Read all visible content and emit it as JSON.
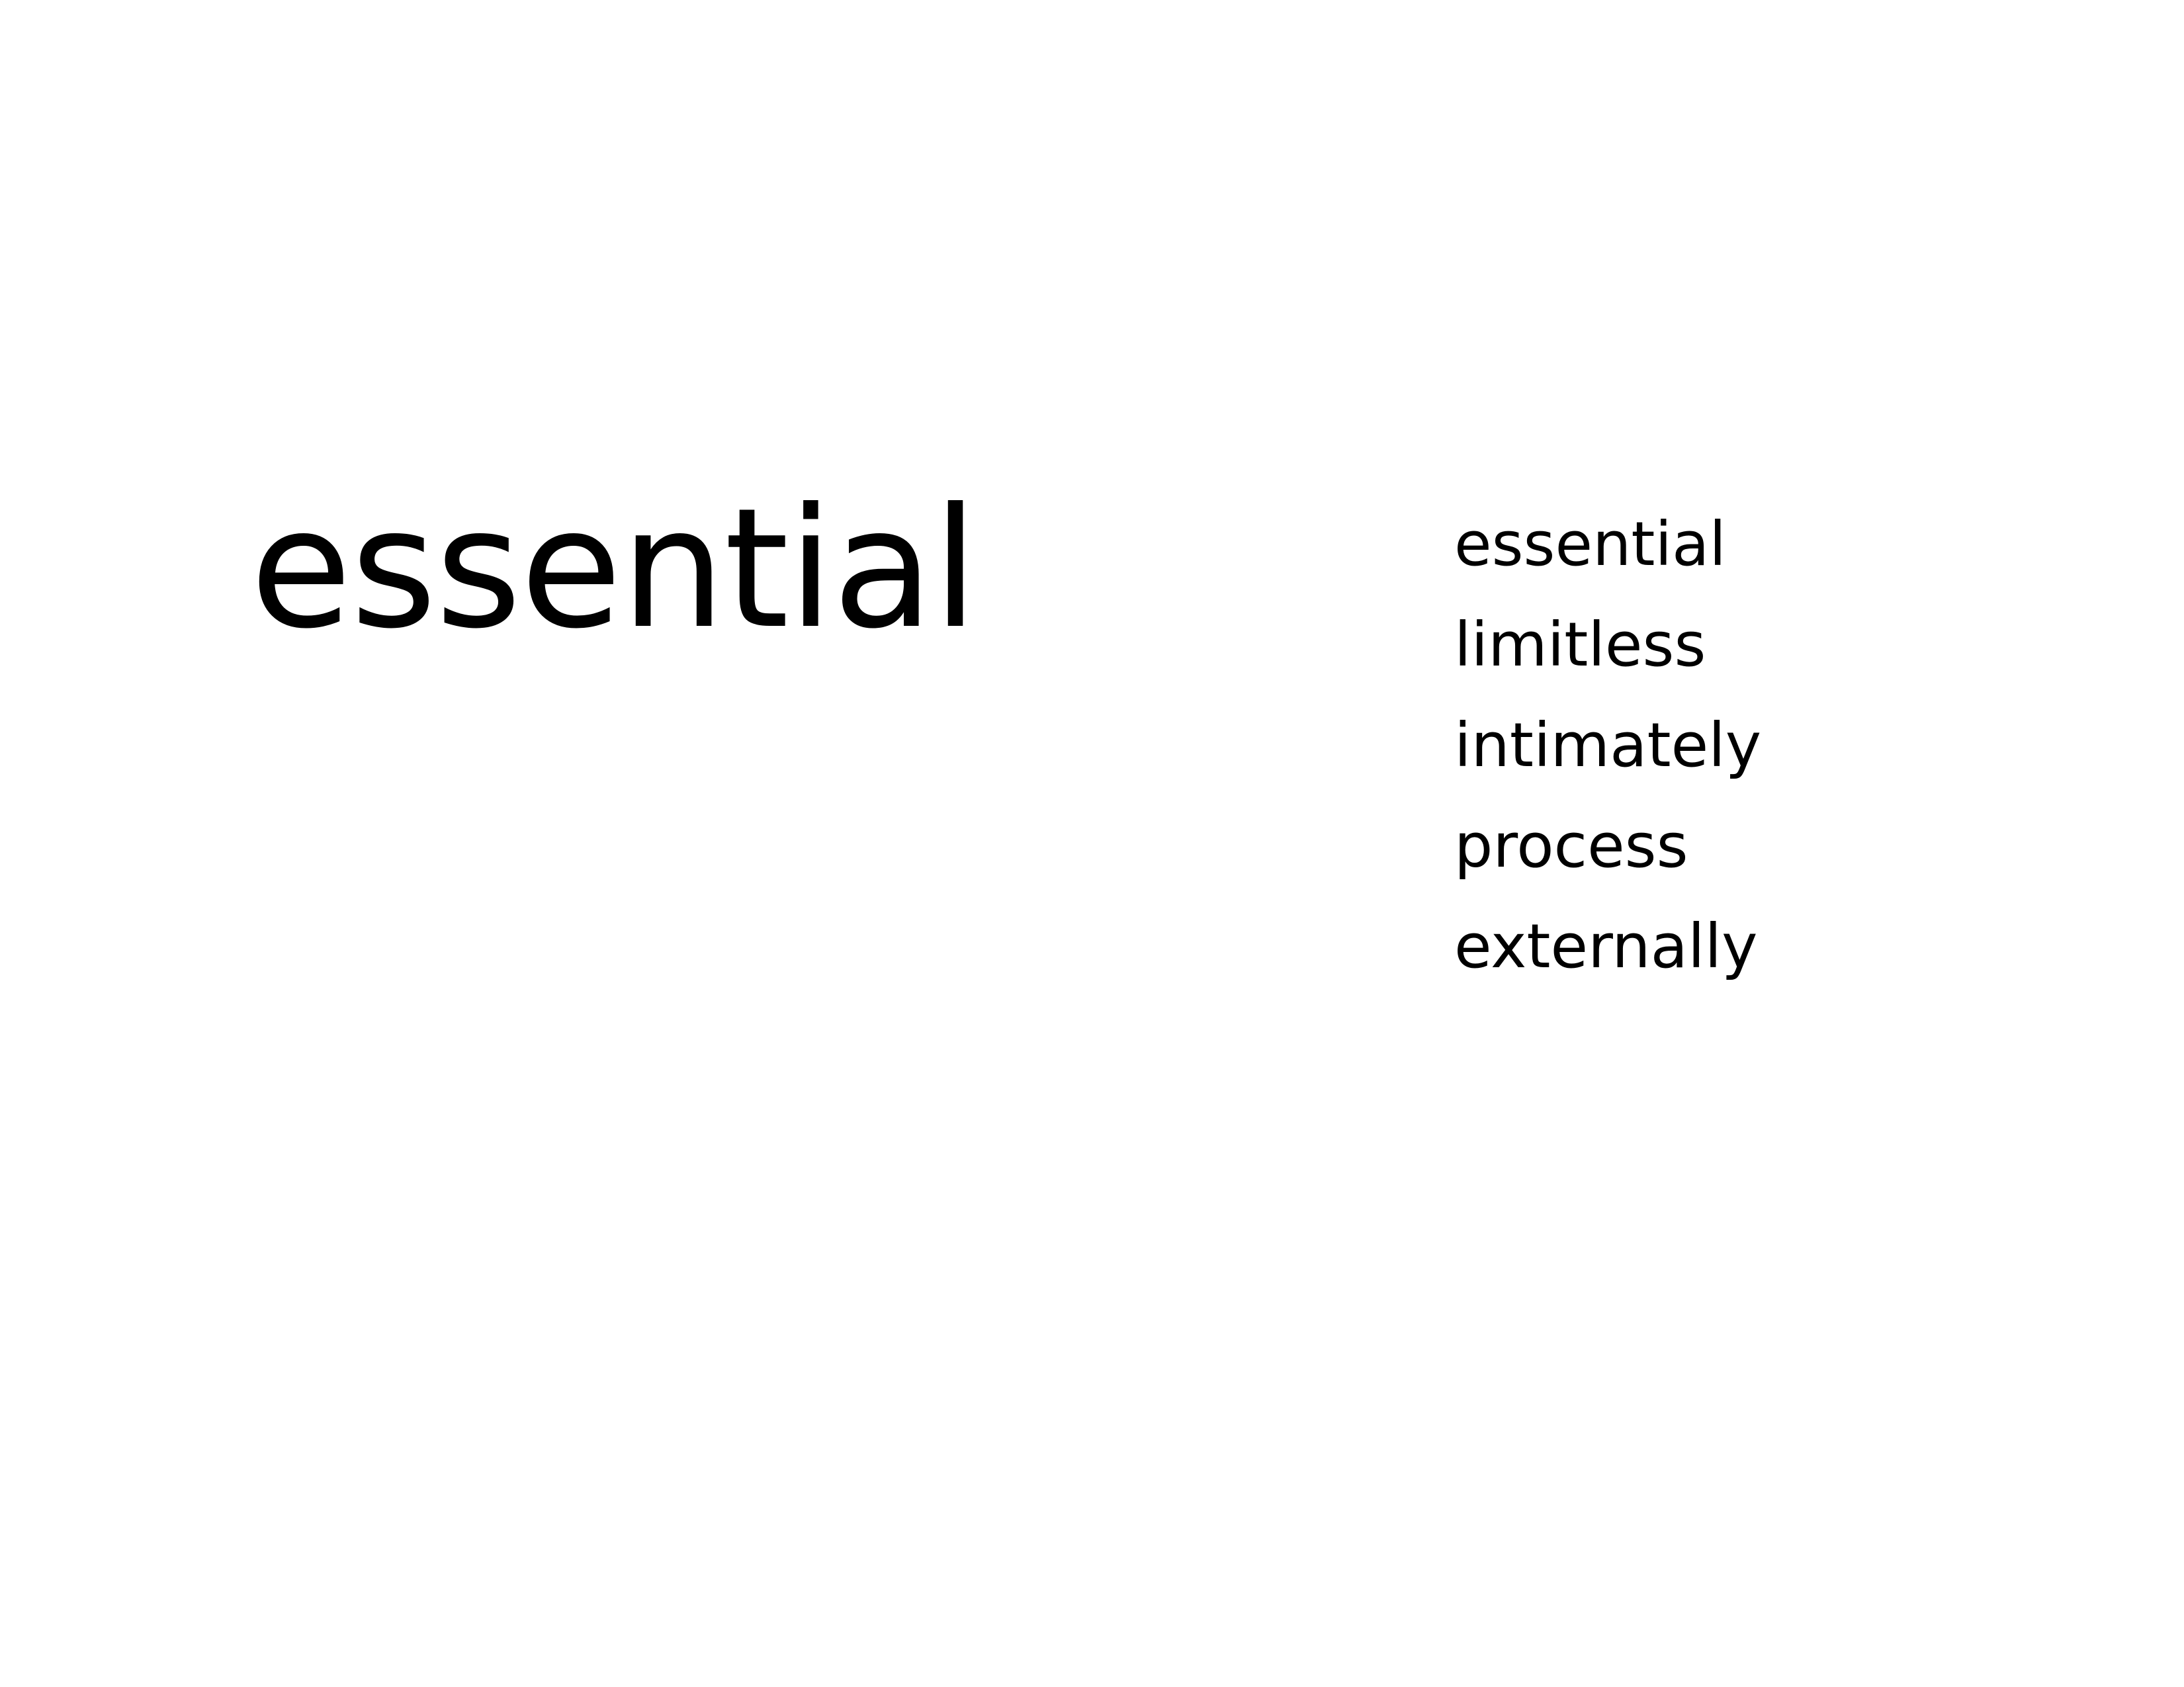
{
  "page": {
    "background_color": "#ffffff",
    "text_color": "#000000"
  },
  "headline": "essential",
  "word_list": [
    "essential",
    "limitless",
    "intimately",
    "process",
    "externally"
  ]
}
